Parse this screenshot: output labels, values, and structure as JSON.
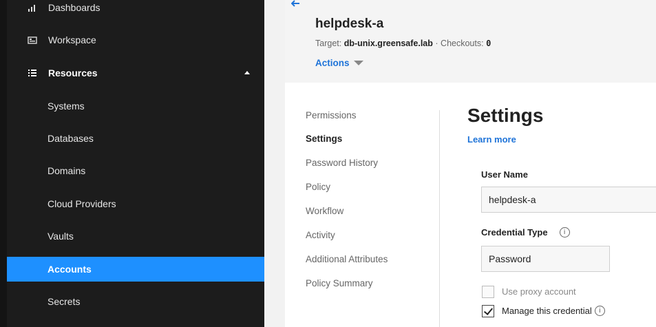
{
  "sidebar": {
    "items": [
      {
        "label": "Dashboards",
        "icon": "bar-chart-icon"
      },
      {
        "label": "Workspace",
        "icon": "workspace-icon"
      },
      {
        "label": "Resources",
        "icon": "list-icon",
        "expanded": true
      }
    ],
    "sub_items": [
      {
        "label": "Systems"
      },
      {
        "label": "Databases"
      },
      {
        "label": "Domains"
      },
      {
        "label": "Cloud Providers"
      },
      {
        "label": "Vaults"
      },
      {
        "label": "Accounts",
        "active": true
      },
      {
        "label": "Secrets"
      }
    ],
    "colors": {
      "background": "#1c1c1c",
      "active": "#1e90ff"
    }
  },
  "header": {
    "title": "helpdesk-a",
    "target_label": "Target:",
    "target_value": "db-unix.greensafe.lab",
    "separator": "·",
    "checkouts_label": "Checkouts:",
    "checkouts_value": "0",
    "actions_label": "Actions"
  },
  "subnav": {
    "items": [
      {
        "label": "Permissions"
      },
      {
        "label": "Settings",
        "current": true
      },
      {
        "label": "Password History"
      },
      {
        "label": "Policy"
      },
      {
        "label": "Workflow"
      },
      {
        "label": "Activity"
      },
      {
        "label": "Additional Attributes"
      },
      {
        "label": "Policy Summary"
      }
    ]
  },
  "settings": {
    "title": "Settings",
    "learn_more": "Learn more",
    "user_name_label": "User Name",
    "user_name_value": "helpdesk-a",
    "credential_type_label": "Credential Type",
    "credential_type_value": "Password",
    "use_proxy_label": "Use proxy account",
    "use_proxy_checked": false,
    "manage_label": "Manage this credential",
    "manage_checked": true,
    "accent_color": "#1e73d8"
  }
}
